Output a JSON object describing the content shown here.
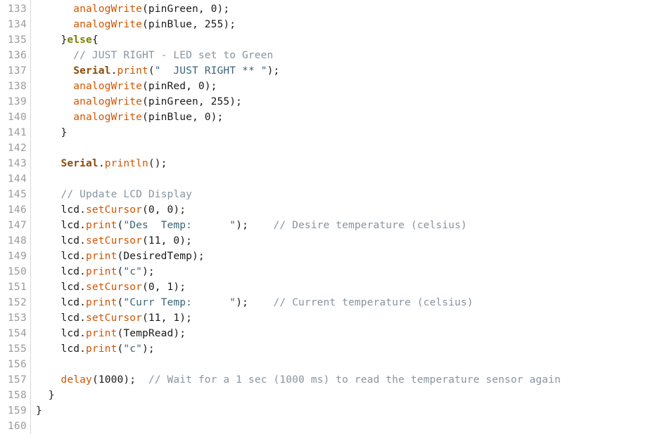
{
  "editor": {
    "app": "arduino-ide-code-editor",
    "language": "arduino-c",
    "first_line_number": 133,
    "last_line_number": 160,
    "colors": {
      "background": "#ffffff",
      "gutter_text": "#9b9b9b",
      "gutter_divider": "#d8d8d8",
      "plain_text": "#1a1a1a",
      "function": "#d35400",
      "object": "#8a4b08",
      "keyword": "#7f7f00",
      "string": "#3c6478",
      "comment": "#8794a0"
    }
  },
  "line_numbers": [
    "133",
    "134",
    "135",
    "136",
    "137",
    "138",
    "139",
    "140",
    "141",
    "142",
    "143",
    "144",
    "145",
    "146",
    "147",
    "148",
    "149",
    "150",
    "151",
    "152",
    "153",
    "154",
    "155",
    "156",
    "157",
    "158",
    "159",
    "160"
  ],
  "lines": [
    {
      "number": "133",
      "text": "      analogWrite(pinGreen, 0);",
      "tokens": [
        {
          "t": "      ",
          "c": "plain"
        },
        {
          "t": "analogWrite",
          "c": "func"
        },
        {
          "t": "(pinGreen, 0);",
          "c": "plain"
        }
      ]
    },
    {
      "number": "134",
      "text": "      analogWrite(pinBlue, 255);",
      "tokens": [
        {
          "t": "      ",
          "c": "plain"
        },
        {
          "t": "analogWrite",
          "c": "func"
        },
        {
          "t": "(pinBlue, 255);",
          "c": "plain"
        }
      ]
    },
    {
      "number": "135",
      "text": "    }else{",
      "tokens": [
        {
          "t": "    }",
          "c": "plain"
        },
        {
          "t": "else",
          "c": "keyword"
        },
        {
          "t": "{",
          "c": "plain"
        }
      ]
    },
    {
      "number": "136",
      "text": "      // JUST RIGHT - LED set to Green",
      "tokens": [
        {
          "t": "      ",
          "c": "plain"
        },
        {
          "t": "// JUST RIGHT - LED set to Green",
          "c": "comment"
        }
      ]
    },
    {
      "number": "137",
      "text": "      Serial.print(\"  JUST RIGHT ** \");",
      "tokens": [
        {
          "t": "      ",
          "c": "plain"
        },
        {
          "t": "Serial",
          "c": "obj"
        },
        {
          "t": ".",
          "c": "plain"
        },
        {
          "t": "print",
          "c": "func"
        },
        {
          "t": "(",
          "c": "plain"
        },
        {
          "t": "\"  JUST RIGHT ** \"",
          "c": "string"
        },
        {
          "t": ");",
          "c": "plain"
        }
      ]
    },
    {
      "number": "138",
      "text": "      analogWrite(pinRed, 0);",
      "tokens": [
        {
          "t": "      ",
          "c": "plain"
        },
        {
          "t": "analogWrite",
          "c": "func"
        },
        {
          "t": "(pinRed, 0);",
          "c": "plain"
        }
      ]
    },
    {
      "number": "139",
      "text": "      analogWrite(pinGreen, 255);",
      "tokens": [
        {
          "t": "      ",
          "c": "plain"
        },
        {
          "t": "analogWrite",
          "c": "func"
        },
        {
          "t": "(pinGreen, 255);",
          "c": "plain"
        }
      ]
    },
    {
      "number": "140",
      "text": "      analogWrite(pinBlue, 0);",
      "tokens": [
        {
          "t": "      ",
          "c": "plain"
        },
        {
          "t": "analogWrite",
          "c": "func"
        },
        {
          "t": "(pinBlue, 0);",
          "c": "plain"
        }
      ]
    },
    {
      "number": "141",
      "text": "    }",
      "tokens": [
        {
          "t": "    }",
          "c": "plain"
        }
      ]
    },
    {
      "number": "142",
      "text": "",
      "tokens": []
    },
    {
      "number": "143",
      "text": "    Serial.println();",
      "tokens": [
        {
          "t": "    ",
          "c": "plain"
        },
        {
          "t": "Serial",
          "c": "obj"
        },
        {
          "t": ".",
          "c": "plain"
        },
        {
          "t": "println",
          "c": "func"
        },
        {
          "t": "();",
          "c": "plain"
        }
      ]
    },
    {
      "number": "144",
      "text": "",
      "tokens": []
    },
    {
      "number": "145",
      "text": "    // Update LCD Display",
      "tokens": [
        {
          "t": "    ",
          "c": "plain"
        },
        {
          "t": "// Update LCD Display",
          "c": "comment"
        }
      ]
    },
    {
      "number": "146",
      "text": "    lcd.setCursor(0, 0);",
      "tokens": [
        {
          "t": "    lcd.",
          "c": "plain"
        },
        {
          "t": "setCursor",
          "c": "func"
        },
        {
          "t": "(0, 0);",
          "c": "plain"
        }
      ]
    },
    {
      "number": "147",
      "text": "    lcd.print(\"Des  Temp:      \");    // Desire temperature (celsius)",
      "tokens": [
        {
          "t": "    lcd.",
          "c": "plain"
        },
        {
          "t": "print",
          "c": "func"
        },
        {
          "t": "(",
          "c": "plain"
        },
        {
          "t": "\"Des  Temp:      \"",
          "c": "string"
        },
        {
          "t": ");    ",
          "c": "plain"
        },
        {
          "t": "// Desire temperature (celsius)",
          "c": "comment"
        }
      ]
    },
    {
      "number": "148",
      "text": "    lcd.setCursor(11, 0);",
      "tokens": [
        {
          "t": "    lcd.",
          "c": "plain"
        },
        {
          "t": "setCursor",
          "c": "func"
        },
        {
          "t": "(11, 0);",
          "c": "plain"
        }
      ]
    },
    {
      "number": "149",
      "text": "    lcd.print(DesiredTemp);",
      "tokens": [
        {
          "t": "    lcd.",
          "c": "plain"
        },
        {
          "t": "print",
          "c": "func"
        },
        {
          "t": "(DesiredTemp);",
          "c": "plain"
        }
      ]
    },
    {
      "number": "150",
      "text": "    lcd.print(\"c\");",
      "tokens": [
        {
          "t": "    lcd.",
          "c": "plain"
        },
        {
          "t": "print",
          "c": "func"
        },
        {
          "t": "(",
          "c": "plain"
        },
        {
          "t": "\"c\"",
          "c": "string"
        },
        {
          "t": ");",
          "c": "plain"
        }
      ]
    },
    {
      "number": "151",
      "text": "    lcd.setCursor(0, 1);",
      "tokens": [
        {
          "t": "    lcd.",
          "c": "plain"
        },
        {
          "t": "setCursor",
          "c": "func"
        },
        {
          "t": "(0, 1);",
          "c": "plain"
        }
      ]
    },
    {
      "number": "152",
      "text": "    lcd.print(\"Curr Temp:      \");    // Current temperature (celsius)",
      "tokens": [
        {
          "t": "    lcd.",
          "c": "plain"
        },
        {
          "t": "print",
          "c": "func"
        },
        {
          "t": "(",
          "c": "plain"
        },
        {
          "t": "\"Curr Temp:      \"",
          "c": "string"
        },
        {
          "t": ");    ",
          "c": "plain"
        },
        {
          "t": "// Current temperature (celsius)",
          "c": "comment"
        }
      ]
    },
    {
      "number": "153",
      "text": "    lcd.setCursor(11, 1);",
      "tokens": [
        {
          "t": "    lcd.",
          "c": "plain"
        },
        {
          "t": "setCursor",
          "c": "func"
        },
        {
          "t": "(11, 1);",
          "c": "plain"
        }
      ]
    },
    {
      "number": "154",
      "text": "    lcd.print(TempRead);",
      "tokens": [
        {
          "t": "    lcd.",
          "c": "plain"
        },
        {
          "t": "print",
          "c": "func"
        },
        {
          "t": "(TempRead);",
          "c": "plain"
        }
      ]
    },
    {
      "number": "155",
      "text": "    lcd.print(\"c\");",
      "tokens": [
        {
          "t": "    lcd.",
          "c": "plain"
        },
        {
          "t": "print",
          "c": "func"
        },
        {
          "t": "(",
          "c": "plain"
        },
        {
          "t": "\"c\"",
          "c": "string"
        },
        {
          "t": ");",
          "c": "plain"
        }
      ]
    },
    {
      "number": "156",
      "text": "",
      "tokens": []
    },
    {
      "number": "157",
      "text": "    delay(1000);  // Wait for a 1 sec (1000 ms) to read the temperature sensor again",
      "tokens": [
        {
          "t": "    ",
          "c": "plain"
        },
        {
          "t": "delay",
          "c": "func"
        },
        {
          "t": "(1000);  ",
          "c": "plain"
        },
        {
          "t": "// Wait for a 1 sec (1000 ms) to read the temperature sensor again",
          "c": "comment"
        }
      ]
    },
    {
      "number": "158",
      "text": "  }",
      "tokens": [
        {
          "t": "  }",
          "c": "plain"
        }
      ]
    },
    {
      "number": "159",
      "text": "}",
      "tokens": [
        {
          "t": "}",
          "c": "plain"
        }
      ]
    },
    {
      "number": "160",
      "text": "",
      "tokens": []
    }
  ]
}
